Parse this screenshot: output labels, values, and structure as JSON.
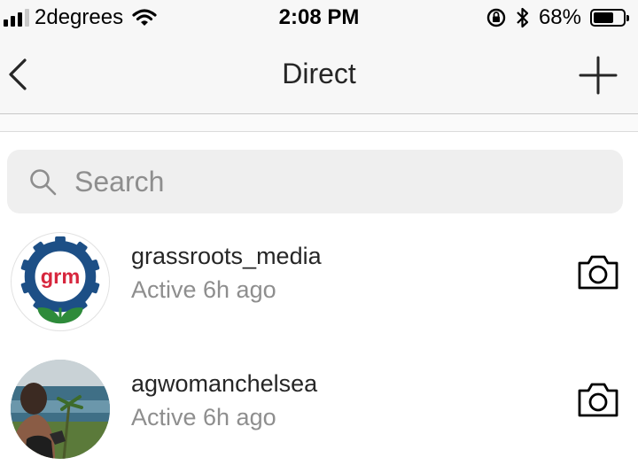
{
  "status_bar": {
    "carrier": "2degrees",
    "time": "2:08 PM",
    "battery_percent": "68%",
    "battery_level": 0.68,
    "signal_bars_active": 3,
    "signal_bars_total": 4
  },
  "nav": {
    "title": "Direct",
    "back_icon": "chevron-left-icon",
    "new_icon": "plus-icon"
  },
  "search": {
    "placeholder": "Search",
    "value": ""
  },
  "threads": [
    {
      "username": "grassroots_media",
      "activity": "Active 6h ago",
      "avatar_text": "grm"
    },
    {
      "username": "agwomanchelsea",
      "activity": "Active 6h ago"
    }
  ],
  "colors": {
    "text_primary": "#262626",
    "text_secondary": "#8e8e8e",
    "bar_background": "#f7f7f7",
    "search_background": "#efefef",
    "logo_gear_blue": "#1d4f86",
    "logo_red": "#d7263d",
    "logo_green": "#2e8b3a"
  }
}
